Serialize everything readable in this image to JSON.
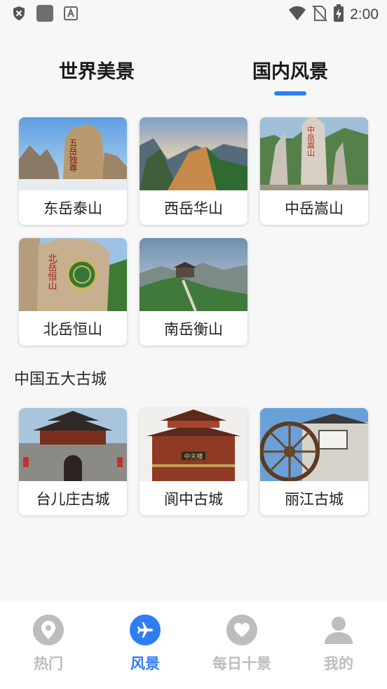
{
  "status_bar": {
    "time": "2:00"
  },
  "tabs": [
    {
      "label": "世界美景"
    },
    {
      "label": "国内风景"
    }
  ],
  "mountains": [
    {
      "label": "东岳泰山",
      "carving": "五岳独尊"
    },
    {
      "label": "西岳华山"
    },
    {
      "label": "中岳嵩山",
      "carving": "中岳嵩山"
    },
    {
      "label": "北岳恒山",
      "carving": "北岳恒山"
    },
    {
      "label": "南岳衡山"
    }
  ],
  "section_title": "中国五大古城",
  "ancient_towns": [
    {
      "label": "台儿庄古城"
    },
    {
      "label": "阆中古城",
      "sign": "中天楼"
    },
    {
      "label": "丽江古城"
    }
  ],
  "bottom_nav": [
    {
      "label": "热门",
      "icon": "location-pin-icon"
    },
    {
      "label": "风景",
      "icon": "airplane-icon"
    },
    {
      "label": "每日十景",
      "icon": "heart-icon"
    },
    {
      "label": "我的",
      "icon": "person-icon"
    }
  ],
  "colors": {
    "accent": "#2f7df5",
    "inactive": "#bdbdbd"
  }
}
